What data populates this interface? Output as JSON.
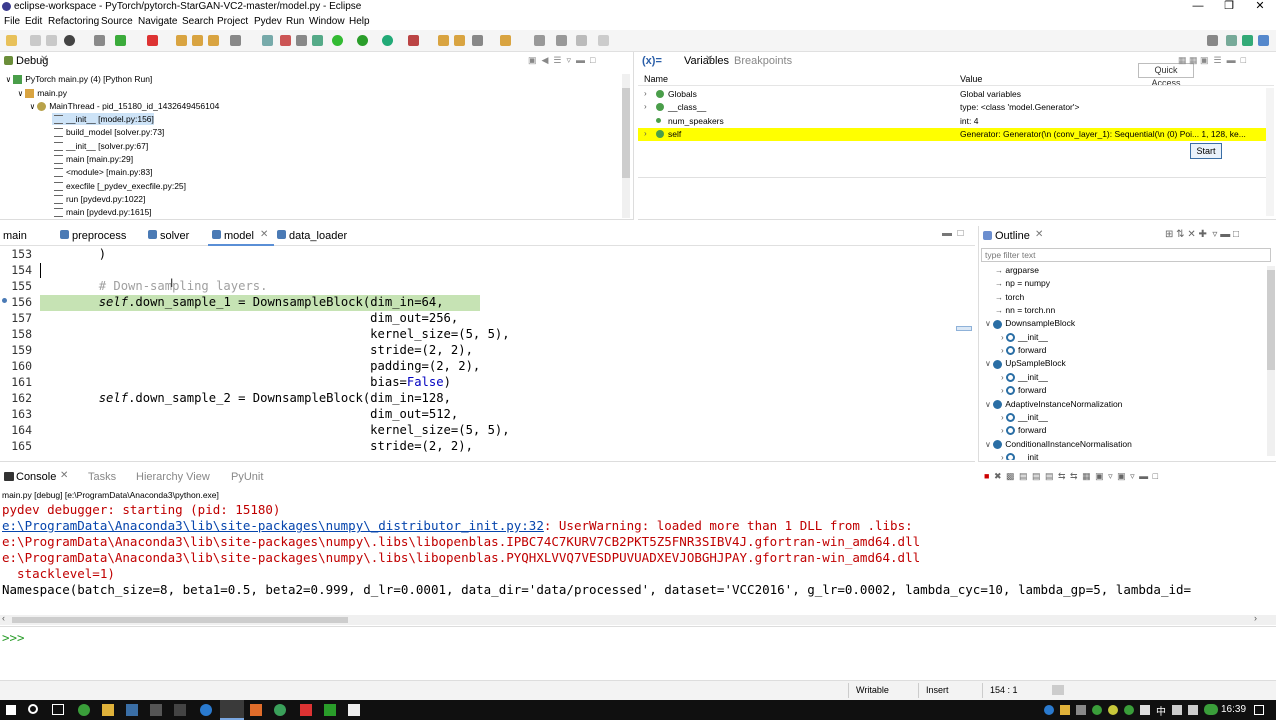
{
  "window": {
    "title": "eclipse-workspace - PyTorch/pytorch-StarGAN-VC2-master/model.py - Eclipse"
  },
  "menu": [
    "File",
    "Edit",
    "Refactoring",
    "Source",
    "Navigate",
    "Search",
    "Project",
    "Pydev",
    "Run",
    "Window",
    "Help"
  ],
  "quick_access": "Quick Access",
  "debug": {
    "title": "Debug",
    "items": [
      "PyTorch main.py (4) [Python Run]",
      "main.py",
      "MainThread - pid_15180_id_1432649456104",
      "__init__ [model.py:156]",
      "build_model [solver.py:73]",
      "__init__ [solver.py:67]",
      "main [main.py:29]",
      "<module> [main.py:83]",
      "execfile [_pydev_execfile.py:25]",
      "run [pydevd.py:1022]",
      "main [pydevd.py:1615]"
    ]
  },
  "variables": {
    "tab": "Variables",
    "tab2": "Breakpoints",
    "col_name": "Name",
    "col_value": "Value",
    "rows": [
      {
        "name": "Globals",
        "value": "Global variables"
      },
      {
        "name": "__class__",
        "value": "type: <class 'model.Generator'>"
      },
      {
        "name": "num_speakers",
        "value": "int: 4"
      },
      {
        "name": "self",
        "value": "Generator: Generator(\\n  (conv_layer_1): Sequential(\\n    (0) Poi...   1, 128, ke..."
      }
    ],
    "tooltip_button": "Start"
  },
  "editor": {
    "tabs": [
      "main",
      "preprocess",
      "solver",
      "model",
      "data_loader"
    ],
    "active_tab": "model",
    "line_numbers": [
      "153",
      "154",
      "155",
      "156",
      "157",
      "158",
      "159",
      "160",
      "161",
      "162",
      "163",
      "164",
      "165"
    ],
    "lines": [
      "        )",
      "",
      "        # Down-sampling layers.",
      "        self.down_sample_1 = DownsampleBlock(dim_in=64,",
      "                                             dim_out=256,",
      "                                             kernel_size=(5, 5),",
      "                                             stride=(2, 2),",
      "                                             padding=(2, 2),",
      "                                             bias=False)",
      "",
      "        self.down_sample_2 = DownsampleBlock(dim_in=128,",
      "                                             dim_out=512,",
      "                                             kernel_size=(5, 5),",
      "                                             stride=(2, 2),"
    ]
  },
  "outline": {
    "title": "Outline",
    "filter_placeholder": "type filter text",
    "items": [
      {
        "label": "argparse",
        "indent": 1
      },
      {
        "label": "np = numpy",
        "indent": 1
      },
      {
        "label": "torch",
        "indent": 1
      },
      {
        "label": "nn = torch.nn",
        "indent": 1
      },
      {
        "label": "DownsampleBlock",
        "indent": 0
      },
      {
        "label": "__init__",
        "indent": 2
      },
      {
        "label": "forward",
        "indent": 2
      },
      {
        "label": "UpSampleBlock",
        "indent": 0
      },
      {
        "label": "__init__",
        "indent": 2
      },
      {
        "label": "forward",
        "indent": 2
      },
      {
        "label": "AdaptiveInstanceNormalization",
        "indent": 0
      },
      {
        "label": "__init__",
        "indent": 2
      },
      {
        "label": "forward",
        "indent": 2
      },
      {
        "label": "ConditionalInstanceNormalisation",
        "indent": 0
      },
      {
        "label": "__init__",
        "indent": 2
      }
    ]
  },
  "console": {
    "tabs": [
      "Console",
      "Tasks",
      "Hierarchy View",
      "PyUnit"
    ],
    "process": "main.py [debug] [e:\\ProgramData\\Anaconda3\\python.exe]",
    "line1": "pydev debugger: starting (pid: 15180)",
    "line2_link": "e:\\ProgramData\\Anaconda3\\lib\\site-packages\\numpy\\_distributor_init.py:32",
    "line2_rest": ": UserWarning: loaded more than 1 DLL from .libs:",
    "line3": "e:\\ProgramData\\Anaconda3\\lib\\site-packages\\numpy\\.libs\\libopenblas.IPBC74C7KURV7CB2PKT5Z5FNR3SIBV4J.gfortran-win_amd64.dll",
    "line4": "e:\\ProgramData\\Anaconda3\\lib\\site-packages\\numpy\\.libs\\libopenblas.PYQHXLVVQ7VESDPUVUADXEVJOBGHJPAY.gfortran-win_amd64.dll",
    "line5": "  stacklevel=1)",
    "line6": "Namespace(batch_size=8, beta1=0.5, beta2=0.999, d_lr=0.0001, data_dir='data/processed', dataset='VCC2016', g_lr=0.0002, lambda_cyc=10, lambda_gp=5, lambda_id=",
    "prompt": ">>>"
  },
  "status": {
    "writable": "Writable",
    "insert": "Insert",
    "position": "154 : 1"
  },
  "taskbar": {
    "time": "16:39"
  }
}
